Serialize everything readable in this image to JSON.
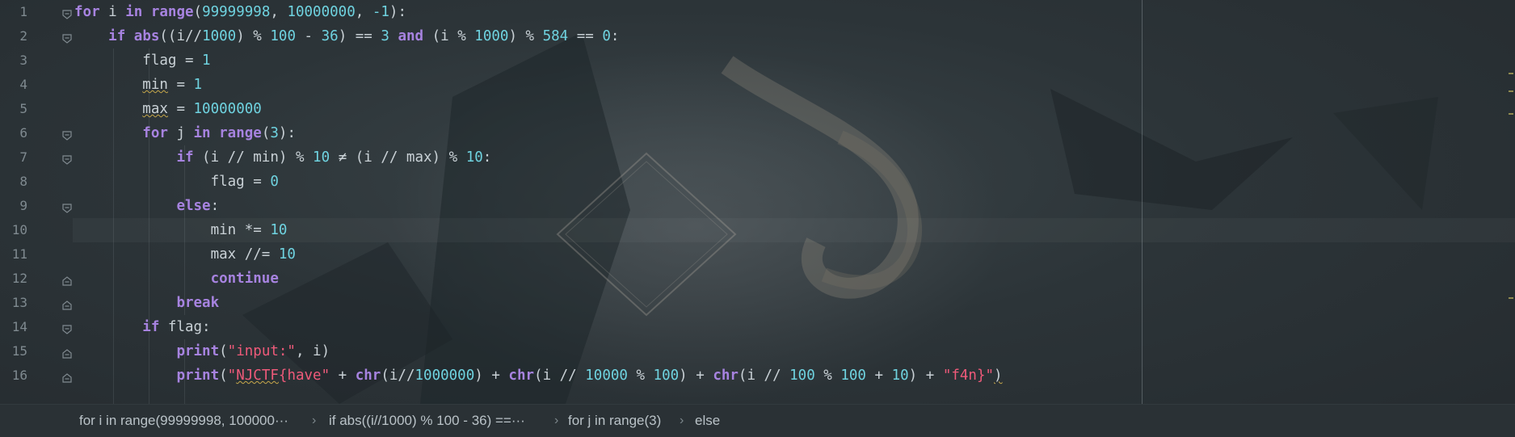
{
  "editor": {
    "line_numbers": [
      "1",
      "2",
      "3",
      "4",
      "5",
      "6",
      "7",
      "8",
      "9",
      "10",
      "11",
      "12",
      "13",
      "14",
      "15",
      "16"
    ],
    "lines": [
      [
        {
          "t": "kw",
          "v": "for"
        },
        {
          "t": "fn",
          "v": " i "
        },
        {
          "t": "kw",
          "v": "in"
        },
        {
          "t": "fn",
          "v": " "
        },
        {
          "t": "kw",
          "v": "range"
        },
        {
          "t": "op",
          "v": "("
        },
        {
          "t": "num",
          "v": "99999998"
        },
        {
          "t": "op",
          "v": ", "
        },
        {
          "t": "num",
          "v": "10000000"
        },
        {
          "t": "op",
          "v": ", "
        },
        {
          "t": "num",
          "v": "-1"
        },
        {
          "t": "op",
          "v": "):"
        }
      ],
      [
        {
          "t": "fn",
          "v": "    "
        },
        {
          "t": "kw",
          "v": "if"
        },
        {
          "t": "fn",
          "v": " "
        },
        {
          "t": "kw",
          "v": "abs"
        },
        {
          "t": "op",
          "v": "((i//"
        },
        {
          "t": "num",
          "v": "1000"
        },
        {
          "t": "op",
          "v": ") % "
        },
        {
          "t": "num",
          "v": "100"
        },
        {
          "t": "op",
          "v": " - "
        },
        {
          "t": "num",
          "v": "36"
        },
        {
          "t": "op",
          "v": ") == "
        },
        {
          "t": "num",
          "v": "3"
        },
        {
          "t": "fn",
          "v": " "
        },
        {
          "t": "kw",
          "v": "and"
        },
        {
          "t": "op",
          "v": " (i % "
        },
        {
          "t": "num",
          "v": "1000"
        },
        {
          "t": "op",
          "v": ") % "
        },
        {
          "t": "num",
          "v": "584"
        },
        {
          "t": "op",
          "v": " == "
        },
        {
          "t": "num",
          "v": "0"
        },
        {
          "t": "op",
          "v": ":"
        }
      ],
      [
        {
          "t": "fn",
          "v": "        flag = "
        },
        {
          "t": "num",
          "v": "1"
        }
      ],
      [
        {
          "t": "fn",
          "v": "        "
        },
        {
          "t": "sq",
          "v": "min"
        },
        {
          "t": "fn",
          "v": " = "
        },
        {
          "t": "num",
          "v": "1"
        }
      ],
      [
        {
          "t": "fn",
          "v": "        "
        },
        {
          "t": "sq",
          "v": "max"
        },
        {
          "t": "fn",
          "v": " = "
        },
        {
          "t": "num",
          "v": "10000000"
        }
      ],
      [
        {
          "t": "fn",
          "v": "        "
        },
        {
          "t": "kw",
          "v": "for"
        },
        {
          "t": "fn",
          "v": " j "
        },
        {
          "t": "kw",
          "v": "in"
        },
        {
          "t": "fn",
          "v": " "
        },
        {
          "t": "kw",
          "v": "range"
        },
        {
          "t": "op",
          "v": "("
        },
        {
          "t": "num",
          "v": "3"
        },
        {
          "t": "op",
          "v": "):"
        }
      ],
      [
        {
          "t": "fn",
          "v": "            "
        },
        {
          "t": "kw",
          "v": "if"
        },
        {
          "t": "op",
          "v": " (i // min) % "
        },
        {
          "t": "num",
          "v": "10"
        },
        {
          "t": "op",
          "v": " ≠ (i // max) % "
        },
        {
          "t": "num",
          "v": "10"
        },
        {
          "t": "op",
          "v": ":"
        }
      ],
      [
        {
          "t": "fn",
          "v": "                flag = "
        },
        {
          "t": "num",
          "v": "0"
        }
      ],
      [
        {
          "t": "fn",
          "v": "            "
        },
        {
          "t": "kw",
          "v": "else"
        },
        {
          "t": "op",
          "v": ":"
        }
      ],
      [
        {
          "t": "fn",
          "v": "                min *= "
        },
        {
          "t": "num",
          "v": "10"
        }
      ],
      [
        {
          "t": "fn",
          "v": "                max //= "
        },
        {
          "t": "num",
          "v": "10"
        }
      ],
      [
        {
          "t": "fn",
          "v": "                "
        },
        {
          "t": "kw",
          "v": "continue"
        }
      ],
      [
        {
          "t": "fn",
          "v": "            "
        },
        {
          "t": "kw",
          "v": "break"
        }
      ],
      [
        {
          "t": "fn",
          "v": "        "
        },
        {
          "t": "kw",
          "v": "if"
        },
        {
          "t": "fn",
          "v": " flag:"
        }
      ],
      [
        {
          "t": "fn",
          "v": "            "
        },
        {
          "t": "kw",
          "v": "print"
        },
        {
          "t": "op",
          "v": "("
        },
        {
          "t": "str",
          "v": "\"input:\""
        },
        {
          "t": "op",
          "v": ", i)"
        }
      ],
      [
        {
          "t": "fn",
          "v": "            "
        },
        {
          "t": "kw",
          "v": "print"
        },
        {
          "t": "op",
          "v": "("
        },
        {
          "t": "str",
          "v": "\""
        },
        {
          "t": "strsq",
          "v": "NJCTF"
        },
        {
          "t": "str",
          "v": "{have\""
        },
        {
          "t": "op",
          "v": " + "
        },
        {
          "t": "kw",
          "v": "chr"
        },
        {
          "t": "op",
          "v": "(i//"
        },
        {
          "t": "num",
          "v": "1000000"
        },
        {
          "t": "op",
          "v": ") + "
        },
        {
          "t": "kw",
          "v": "chr"
        },
        {
          "t": "op",
          "v": "(i // "
        },
        {
          "t": "num",
          "v": "10000"
        },
        {
          "t": "op",
          "v": " % "
        },
        {
          "t": "num",
          "v": "100"
        },
        {
          "t": "op",
          "v": ") + "
        },
        {
          "t": "kw",
          "v": "chr"
        },
        {
          "t": "op",
          "v": "(i // "
        },
        {
          "t": "num",
          "v": "100"
        },
        {
          "t": "op",
          "v": " % "
        },
        {
          "t": "num",
          "v": "100"
        },
        {
          "t": "op",
          "v": " + "
        },
        {
          "t": "num",
          "v": "10"
        },
        {
          "t": "op",
          "v": ") + "
        },
        {
          "t": "str",
          "v": "\"f4n}\""
        },
        {
          "t": "sq",
          "v": ")"
        }
      ]
    ],
    "fold_icons": [
      "fold-open-icon",
      "fold-open-icon",
      "",
      "",
      "",
      "fold-open-icon",
      "fold-open-icon",
      "",
      "fold-open-icon",
      "",
      "",
      "fold-close-icon",
      "fold-close-icon",
      "fold-open-icon",
      "fold-close-icon",
      "fold-close-icon"
    ]
  },
  "breadcrumbs": [
    "for i in range(99999998, 100000···",
    "if abs((i//1000) % 100 - 36) ==···",
    "for j in range(3)",
    "else"
  ],
  "colors": {
    "keyword": "#a783e0",
    "number": "#6fd3e0",
    "string": "#ef5a7a",
    "text": "#c9d1d6",
    "warning": "#c7a84a"
  }
}
